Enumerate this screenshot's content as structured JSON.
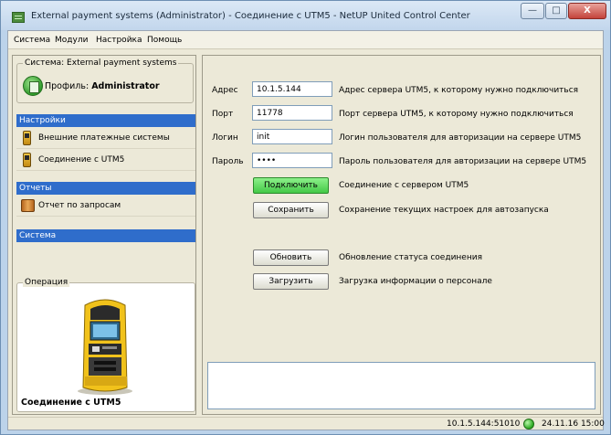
{
  "window": {
    "title": "External payment systems (Administrator) - Соединение с UTM5 - NetUP United Control Center",
    "min_glyph": "—",
    "max_glyph": "□",
    "close_glyph": "X"
  },
  "menu": {
    "items": [
      "Система",
      "Модули",
      "Настройка",
      "Помощь"
    ]
  },
  "sidebar": {
    "system_group_label": "Система: External payment systems",
    "profile_prefix": "Профиль: ",
    "profile_name": "Administrator",
    "settings_header": "Настройки",
    "settings_items": [
      "Внешние платежные системы",
      "Соединение с UTM5"
    ],
    "reports_header": "Отчеты",
    "reports_items": [
      "Отчет по запросам"
    ],
    "system_header": "Система",
    "operation_label": "Операция",
    "operation_caption": "Соединение с UTM5"
  },
  "form": {
    "address": {
      "label": "Адрес",
      "value": "10.1.5.144",
      "desc": "Адрес сервера UTM5, к которому нужно подключиться"
    },
    "port": {
      "label": "Порт",
      "value": "11778",
      "desc": "Порт сервера UTM5, к которому нужно подключиться"
    },
    "login": {
      "label": "Логин",
      "value": "init",
      "desc": "Логин пользователя для авторизации на сервере UTM5"
    },
    "password": {
      "label": "Пароль",
      "value": "••••",
      "desc": "Пароль пользователя для авторизации на сервере UTM5"
    }
  },
  "actions": {
    "connect": {
      "label": "Подключить",
      "desc": "Соединение с сервером UTM5",
      "color": "#44c947"
    },
    "save": {
      "label": "Сохранить",
      "desc": "Сохранение текущих настроек для автозапуска"
    },
    "refresh": {
      "label": "Обновить",
      "desc": "Обновление статуса соединения"
    },
    "load": {
      "label": "Загрузить",
      "desc": "Загрузка информации о персонале"
    }
  },
  "status": {
    "address": "10.1.5.144:51010",
    "connection_color": "#2aa81f",
    "datetime": "24.11.16 15:00"
  },
  "colors": {
    "section_header": "#2f6dcb"
  }
}
